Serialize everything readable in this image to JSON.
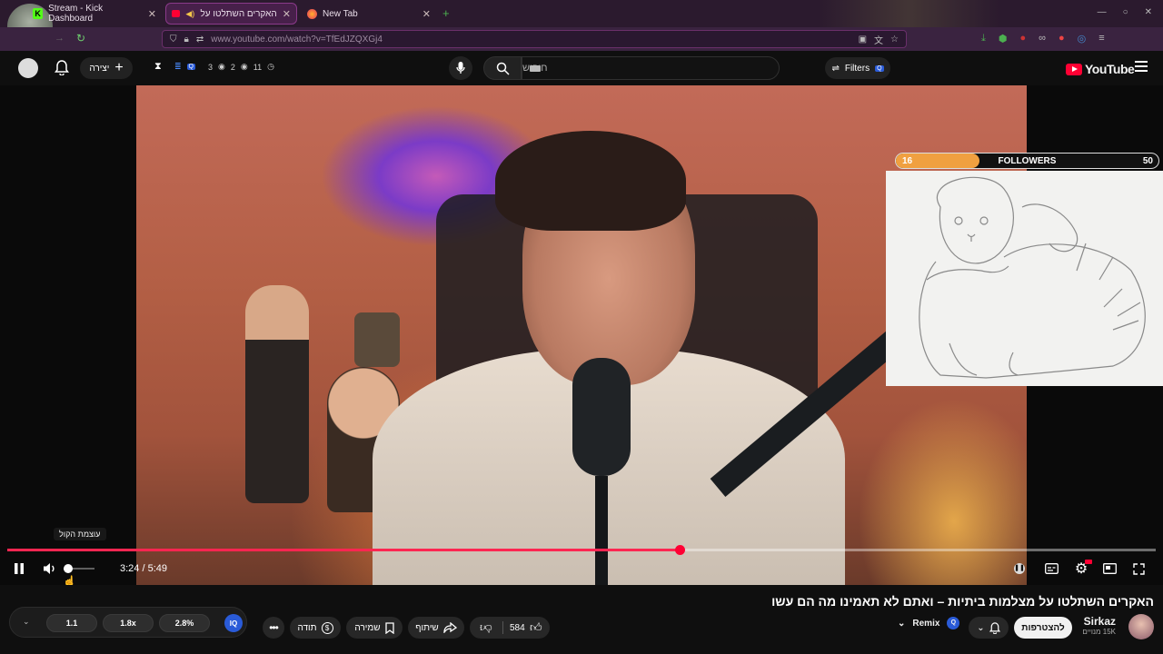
{
  "tabs": [
    {
      "title": "Stream - Kick Dashboard"
    },
    {
      "title": "האקרים השתלטו על מצ"
    },
    {
      "title": "New Tab"
    }
  ],
  "address": {
    "url": "www.youtube.com/watch?v=TfEdJZQXGj4"
  },
  "header": {
    "create_label": "יצירה",
    "stats": {
      "a": "3",
      "b": "2",
      "c": "11"
    },
    "search_placeholder": "חיפוש",
    "filters_label": "Filters",
    "logo_text": "YouTube"
  },
  "overlay": {
    "followers_label": "FOLLOWERS",
    "followers_current": "16",
    "followers_goal": "50",
    "progress_fraction": 0.32
  },
  "player": {
    "tooltip": "עוצמת הקול",
    "time_current": "3:24",
    "time_total": "5:49",
    "progress_fraction": 0.586,
    "volume_fraction": 0.15
  },
  "video": {
    "title": "האקרים השתלטו על מצלמות ביתיות – ואתם לא תאמינו מה הם עשו",
    "channel_name": "Sirkaz",
    "subscribers": "15K מנויים",
    "join_label": "להצטרפות",
    "remix_label": "Remix",
    "likes": "584",
    "share_label": "שיתוף",
    "save_label": "שמירה",
    "thanks_label": "תודה"
  },
  "speeds": [
    "1.1",
    "1.8x",
    "2.8%"
  ]
}
